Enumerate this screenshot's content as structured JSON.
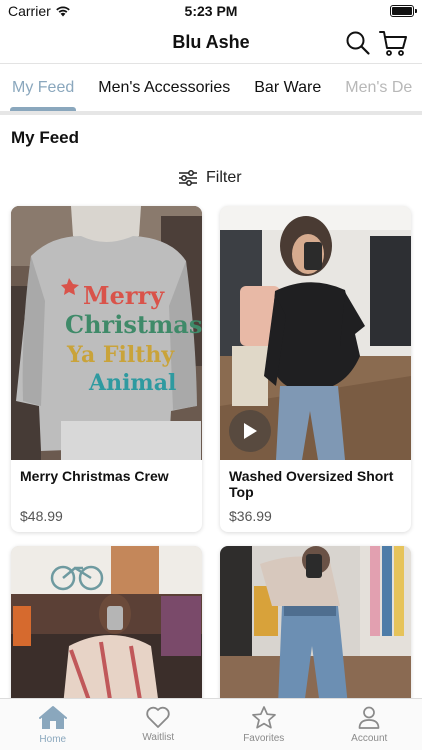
{
  "status_bar": {
    "carrier": "Carrier",
    "time": "5:23 PM"
  },
  "header": {
    "title": "Blu Ashe"
  },
  "tabs": [
    {
      "label": "My Feed"
    },
    {
      "label": "Men's Accessories"
    },
    {
      "label": "Bar Ware"
    },
    {
      "label": "Men's De"
    }
  ],
  "section": {
    "title": "My Feed"
  },
  "filter": {
    "label": "Filter"
  },
  "products": [
    {
      "name": "Merry Christmas Crew",
      "price": "$48.99"
    },
    {
      "name": "Washed Oversized Short Top",
      "price": "$36.99"
    },
    {
      "name": "",
      "price": ""
    },
    {
      "name": "",
      "price": ""
    }
  ],
  "sweatshirt_print": [
    "Merry",
    "Christmas",
    "Ya Filthy",
    "Animal"
  ],
  "bottom_nav": [
    {
      "label": "Home"
    },
    {
      "label": "Waitlist"
    },
    {
      "label": "Favorites"
    },
    {
      "label": "Account"
    }
  ],
  "colors": {
    "accent": "#8aa7bd",
    "inactive": "#8a8a8a"
  }
}
